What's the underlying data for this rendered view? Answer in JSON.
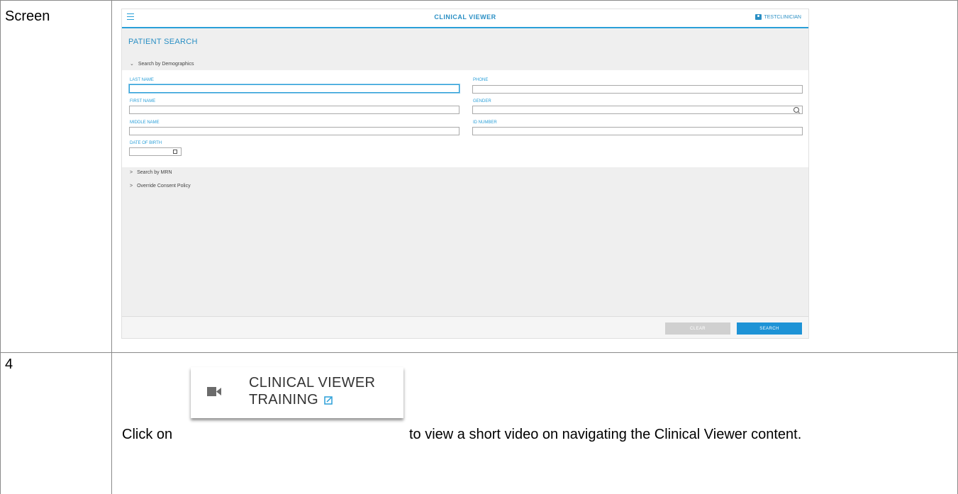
{
  "doc": {
    "row1_label": "Screen",
    "row2_label": "4",
    "instruction_before": "Click on",
    "instruction_after": "to view a short video on navigating the Clinical Viewer content."
  },
  "app": {
    "title": "CLINICAL VIEWER",
    "user": "TESTCLINICIAN",
    "page_title": "PATIENT SEARCH",
    "sections": {
      "demographics": "Search by Demographics",
      "mrn": "Search by MRN",
      "consent": "Override Consent Policy"
    },
    "fields": {
      "last_name": "LAST NAME",
      "first_name": "FIRST NAME",
      "middle_name": "MIDDLE NAME",
      "dob": "DATE OF BIRTH",
      "phone": "PHONE",
      "gender": "GENDER",
      "id_number": "ID NUMBER"
    },
    "buttons": {
      "clear": "CLEAR",
      "search": "SEARCH"
    }
  },
  "training": {
    "line1": "CLINICAL VIEWER",
    "line2": "TRAINING"
  },
  "icons": {
    "menu": "hamburger-icon",
    "user": "user-icon",
    "gender_lookup": "search-icon",
    "dob_picker": "calendar-icon",
    "video": "video-camera-icon",
    "external": "external-link-icon"
  },
  "colors": {
    "accent": "#2a9fd8",
    "search_button": "#1e93d6",
    "clear_button": "#d0d0d0"
  }
}
